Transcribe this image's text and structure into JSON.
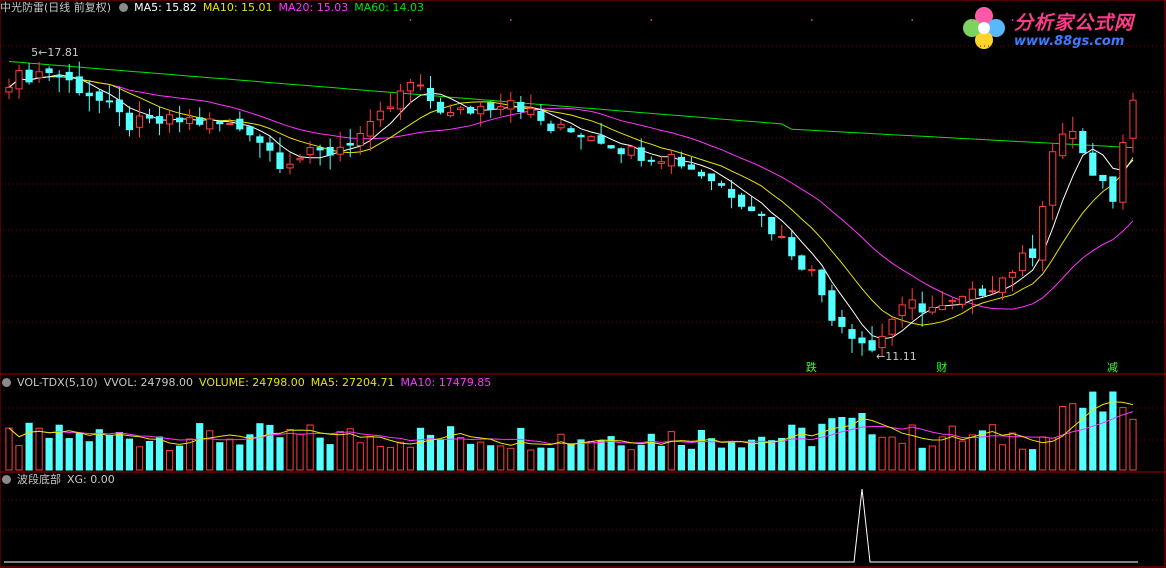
{
  "main": {
    "title": "中光防雷(日线 前复权)",
    "ma5_label": "MA5: 15.82",
    "ma10_label": "MA10: 15.01",
    "ma20_label": "MA20: 15.03",
    "ma60_label": "MA60: 14.03",
    "high_marker": "17.81",
    "low_marker": "11.11",
    "signals": [
      "跌",
      "财",
      "减"
    ]
  },
  "volume": {
    "title": "VOL-TDX(5,10)",
    "vvol_label": "VVOL: 24798.00",
    "volume_label": "VOLUME: 24798.00",
    "ma5_label": "MA5: 27204.71",
    "ma10_label": "MA10: 17479.85"
  },
  "indicator": {
    "title": "波段底部",
    "xg_label": "XG: 0.00"
  },
  "logo": {
    "title": "分析家公式网",
    "url": "www.88gs.com"
  },
  "colors": {
    "up": "#ff3c3c",
    "down": "#54ffff",
    "ma5": "#ffffff",
    "ma10": "#e6e600",
    "ma20": "#ff33ff",
    "ma60": "#00e600",
    "grid": "#800000"
  },
  "chart_data": [
    {
      "type": "candlestick",
      "x_count": 113,
      "ylim": [
        11.11,
        17.81
      ],
      "candles": [
        [
          16.9,
          17.3,
          17.45,
          16.7
        ],
        [
          17.25,
          17.5,
          17.81,
          17.2
        ],
        [
          17.5,
          17.4,
          17.7,
          17.2
        ],
        [
          17.4,
          17.3,
          17.6,
          17.1
        ],
        [
          17.3,
          17.2,
          17.5,
          17.05
        ],
        [
          17.2,
          17.0,
          17.35,
          16.8
        ],
        [
          17.0,
          16.9,
          17.1,
          16.7
        ],
        [
          16.9,
          17.0,
          17.2,
          16.75
        ],
        [
          17.0,
          17.0,
          17.3,
          16.8
        ],
        [
          17.0,
          16.5,
          17.1,
          16.4
        ],
        [
          16.5,
          16.0,
          16.6,
          15.8
        ],
        [
          16.0,
          17.1,
          17.3,
          15.9
        ],
        [
          17.1,
          16.0,
          17.2,
          15.8
        ],
        [
          16.0,
          16.3,
          16.5,
          15.8
        ],
        [
          16.3,
          16.5,
          16.9,
          16.1
        ],
        [
          16.5,
          16.3,
          16.8,
          16.1
        ],
        [
          16.3,
          16.5,
          16.8,
          16.2
        ],
        [
          16.5,
          16.4,
          16.7,
          16.2
        ],
        [
          16.4,
          16.5,
          16.7,
          16.2
        ],
        [
          16.5,
          16.4,
          16.7,
          16.2
        ],
        [
          16.4,
          16.2,
          16.6,
          16.0
        ],
        [
          16.2,
          16.4,
          16.6,
          16.1
        ],
        [
          16.4,
          16.3,
          16.6,
          16.1
        ],
        [
          16.3,
          16.1,
          16.5,
          15.9
        ],
        [
          16.1,
          16.5,
          16.7,
          16.0
        ],
        [
          16.5,
          16.2,
          16.7,
          16.0
        ],
        [
          16.2,
          15.6,
          16.3,
          15.4
        ],
        [
          15.6,
          15.4,
          15.8,
          15.1
        ],
        [
          15.4,
          15.5,
          15.7,
          15.2
        ],
        [
          15.5,
          15.6,
          15.8,
          15.4
        ],
        [
          15.6,
          15.5,
          15.9,
          15.3
        ],
        [
          15.5,
          15.7,
          16.0,
          15.3
        ],
        [
          15.7,
          15.3,
          15.9,
          15.1
        ],
        [
          15.3,
          15.8,
          16.0,
          15.2
        ],
        [
          15.8,
          16.0,
          16.2,
          15.7
        ],
        [
          16.0,
          15.9,
          16.3,
          15.7
        ],
        [
          15.9,
          16.1,
          16.4,
          15.8
        ],
        [
          16.1,
          16.3,
          16.6,
          16.0
        ],
        [
          16.3,
          16.6,
          16.8,
          16.2
        ],
        [
          16.6,
          16.9,
          17.0,
          16.4
        ],
        [
          16.9,
          17.3,
          17.5,
          16.7
        ],
        [
          17.3,
          16.8,
          17.4,
          16.5
        ],
        [
          16.8,
          16.6,
          16.9,
          16.4
        ],
        [
          16.6,
          16.2,
          16.7,
          16.0
        ],
        [
          16.2,
          16.6,
          16.8,
          16.1
        ],
        [
          16.6,
          16.4,
          16.8,
          16.2
        ],
        [
          16.4,
          16.8,
          17.0,
          16.3
        ],
        [
          16.8,
          17.0,
          17.1,
          16.6
        ],
        [
          17.0,
          16.5,
          17.1,
          16.3
        ],
        [
          16.5,
          16.7,
          16.9,
          16.4
        ],
        [
          16.7,
          17.1,
          17.2,
          16.6
        ],
        [
          17.1,
          16.9,
          17.3,
          16.7
        ],
        [
          16.9,
          16.5,
          17.0,
          16.3
        ],
        [
          16.5,
          16.1,
          16.6,
          15.9
        ],
        [
          16.1,
          15.6,
          16.2,
          15.4
        ],
        [
          15.6,
          15.8,
          16.0,
          15.4
        ],
        [
          15.8,
          16.1,
          16.3,
          15.6
        ],
        [
          16.1,
          15.9,
          16.3,
          15.7
        ],
        [
          15.9,
          16.0,
          16.2,
          15.7
        ],
        [
          16.0,
          16.1,
          16.3,
          15.8
        ],
        [
          16.1,
          15.8,
          16.3,
          15.6
        ],
        [
          15.8,
          15.6,
          16.0,
          15.4
        ],
        [
          15.6,
          15.3,
          15.8,
          15.1
        ],
        [
          15.3,
          15.7,
          15.9,
          15.1
        ],
        [
          15.7,
          15.5,
          15.9,
          15.3
        ],
        [
          15.5,
          15.6,
          15.8,
          15.3
        ],
        [
          15.6,
          15.4,
          15.8,
          15.2
        ],
        [
          15.4,
          15.6,
          15.8,
          15.2
        ],
        [
          15.6,
          15.8,
          16.0,
          15.4
        ],
        [
          15.8,
          15.6,
          16.0,
          15.4
        ],
        [
          15.6,
          15.2,
          15.7,
          15.0
        ],
        [
          15.2,
          15.0,
          15.3,
          14.9
        ],
        [
          15.0,
          14.8,
          15.1,
          14.6
        ],
        [
          14.8,
          14.4,
          15.0,
          14.3
        ],
        [
          14.4,
          14.3,
          14.6,
          14.1
        ],
        [
          14.3,
          14.0,
          14.4,
          13.9
        ]
      ],
      "ma5": [
        17.1,
        17.2,
        17.1,
        17.0,
        16.9,
        16.8,
        16.7,
        16.6,
        16.6,
        16.5,
        16.4,
        16.4,
        16.3,
        16.3
      ],
      "ma10": [
        16.9,
        17.0,
        17.0,
        16.9,
        16.9,
        16.8,
        16.7,
        16.6,
        16.5,
        16.4,
        16.3,
        16.3
      ],
      "ma20": [
        17.0,
        17.0,
        16.9,
        16.9,
        16.8,
        16.8,
        16.7,
        16.6,
        16.5,
        16.4
      ],
      "ma60": [
        17.6,
        17.5,
        17.3,
        17.1,
        16.9,
        16.7,
        16.5,
        16.3
      ],
      "signals": [
        {
          "x": 57,
          "label": "跌"
        },
        {
          "x": 66,
          "label": "财"
        },
        {
          "x": 109,
          "label": "减"
        }
      ]
    },
    {
      "type": "volume",
      "mode": "bars"
    },
    {
      "type": "line",
      "name": "XG",
      "value": 0.0
    }
  ]
}
